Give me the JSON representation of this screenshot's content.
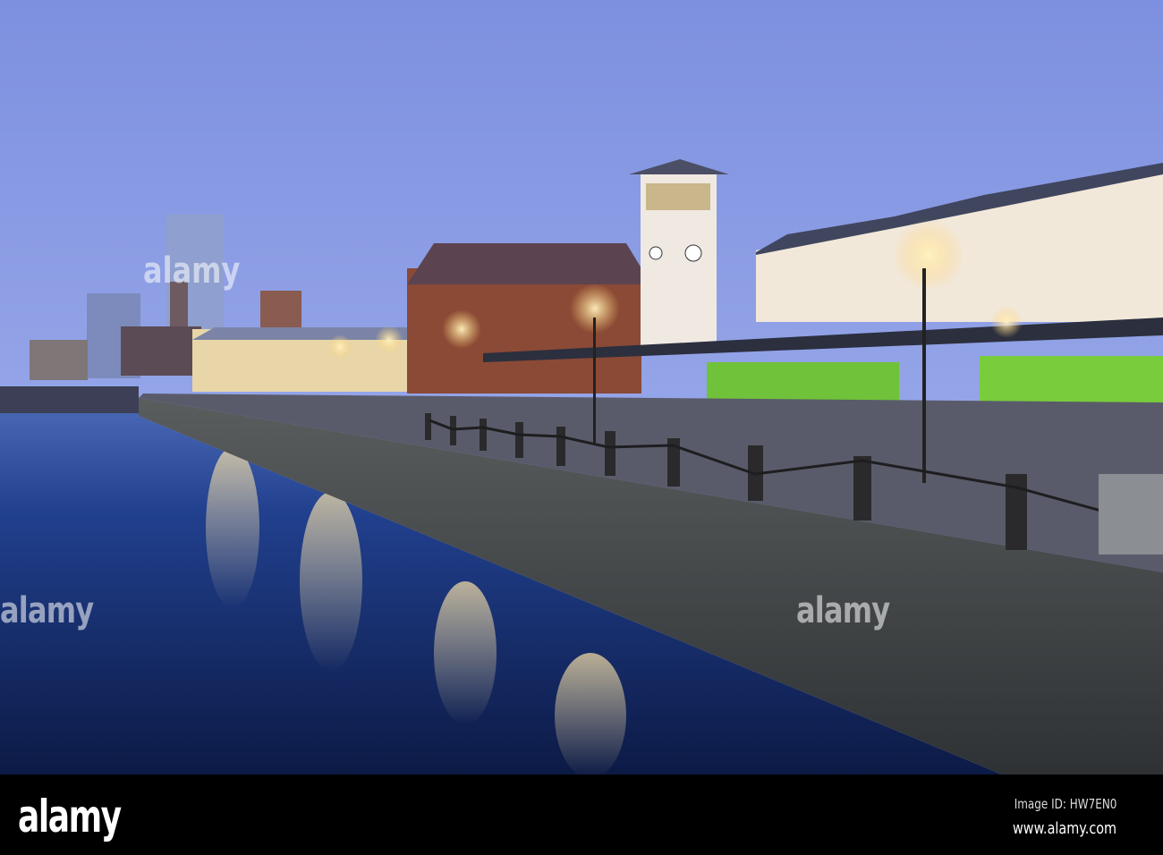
{
  "photo": {
    "watermark": "alamy",
    "palette": {
      "sky_top": "#7f93e0",
      "sky_horizon": "#a8b6f0",
      "water": "#14285e",
      "wall": "#3e4246",
      "lights": "#ffd98a"
    }
  },
  "footer": {
    "logo": "alamy",
    "image_id": "Image ID: HW7EN0",
    "website": "www.alamy.com"
  }
}
